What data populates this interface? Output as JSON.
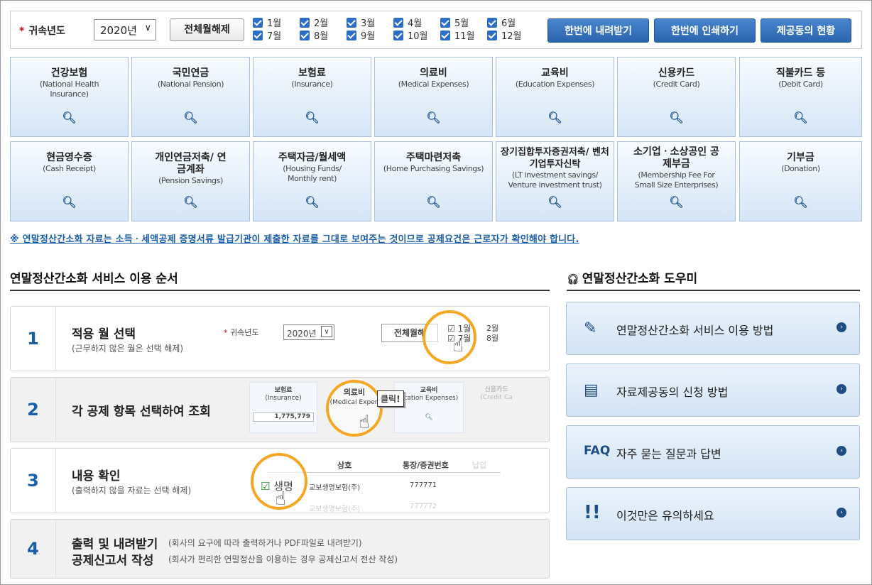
{
  "filter": {
    "year_label": "귀속년도",
    "year_value": "2020년",
    "uncheck_all": "전체월해제",
    "months": [
      "1월",
      "2월",
      "3월",
      "4월",
      "5월",
      "6월",
      "7월",
      "8월",
      "9월",
      "10월",
      "11월",
      "12월"
    ],
    "download_all": "한번에 내려받기",
    "print_all": "한번에 인쇄하기",
    "consent_status": "제공동의 현황"
  },
  "categories": [
    {
      "ko": "건강보험",
      "en": "(National Health Insurance)"
    },
    {
      "ko": "국민연금",
      "en": "(National Pension)"
    },
    {
      "ko": "보험료",
      "en": "(Insurance)"
    },
    {
      "ko": "의료비",
      "en": "(Medical Expenses)"
    },
    {
      "ko": "교육비",
      "en": "(Education Expenses)"
    },
    {
      "ko": "신용카드",
      "en": "(Credit Card)"
    },
    {
      "ko": "직불카드 등",
      "en": "(Debit Card)"
    },
    {
      "ko": "현금영수증",
      "en": "(Cash Receipt)"
    },
    {
      "ko": "개인연금저축/ 연금계좌",
      "en": "(Pension Savings)"
    },
    {
      "ko": "주택자금/월세액",
      "en": "(Housing Funds/ Monthly rent)"
    },
    {
      "ko": "주택마련저축",
      "en": "(Home Purchasing Savings)"
    },
    {
      "ko": "장기집합투자증권저축/ 벤처기업투자신탁",
      "en": "(LT investment savings/ Venture investment trust)"
    },
    {
      "ko": "소기업ㆍ소상공인 공제부금",
      "en": "(Membership Fee For Small Size Enterprises)"
    },
    {
      "ko": "기부금",
      "en": "(Donation)"
    }
  ],
  "notice": "※ 연말정산간소화 자료는 소득ㆍ세액공제 증명서류 발급기관이 제출한 자료를 그대로 보여주는 것이므로 공제요건은 근로자가 확인해야 합니다.",
  "steps_section": {
    "title": "연말정산간소화 서비스 이용 순서",
    "steps": [
      {
        "num": "1",
        "title": "적용 월 선택",
        "sub": "(근무하지 않은 월은 선택 해제)"
      },
      {
        "num": "2",
        "title": "각 공제 항목 선택하여 조회",
        "sub": ""
      },
      {
        "num": "3",
        "title": "내용 확인",
        "sub": "(출력하지 않을 자료는 선택 해제)"
      },
      {
        "num": "4",
        "title": "출력 및 내려받기",
        "title2": "공제신고서 작성",
        "sub": "(회사의 요구에 따라 출력하거나 PDF파일로 내려받기)",
        "sub2": "(회사가 편리한 연말정산을 이용하는 경우 공제신고서 전산 작성)"
      }
    ],
    "illus1": {
      "year_label": "귀속년도",
      "year_value": "2020년",
      "btn": "전체월해",
      "m1": "1월",
      "m7": "7월",
      "m2": "2월",
      "m8": "8월"
    },
    "illus2": {
      "ins": "보험료",
      "ins_en": "(Insurance)",
      "ins_val": "1,775,779",
      "med": "의료비",
      "med_en": "(Medical Expen",
      "click": "클릭!",
      "edu": "교육비",
      "edu_en": "ucation Expenses)",
      "card": "신용카드",
      "card_en": "(Credit Ca"
    },
    "illus3": {
      "col1": "상호",
      "col2": "통장/증권번호",
      "col3": "납입",
      "row_label": "생명",
      "row_co": "교보생명보험(주)",
      "row_no": "777771",
      "row2_co": "교보생명보험(주)",
      "row2_no": "777772"
    }
  },
  "helper_section": {
    "title": "연말정산간소화 도우미",
    "items": [
      {
        "icon": "document-edit-icon",
        "glyph": "✎",
        "label": "연말정산간소화 서비스 이용 방법"
      },
      {
        "icon": "form-icon",
        "glyph": "▤",
        "label": "자료제공동의 신청 방법"
      },
      {
        "icon": "faq-icon",
        "glyph": "FAQ",
        "label": "자주 묻는 질문과 답변"
      },
      {
        "icon": "warning-icon",
        "glyph": "!!",
        "label": "이것만은 유의하세요"
      }
    ]
  }
}
